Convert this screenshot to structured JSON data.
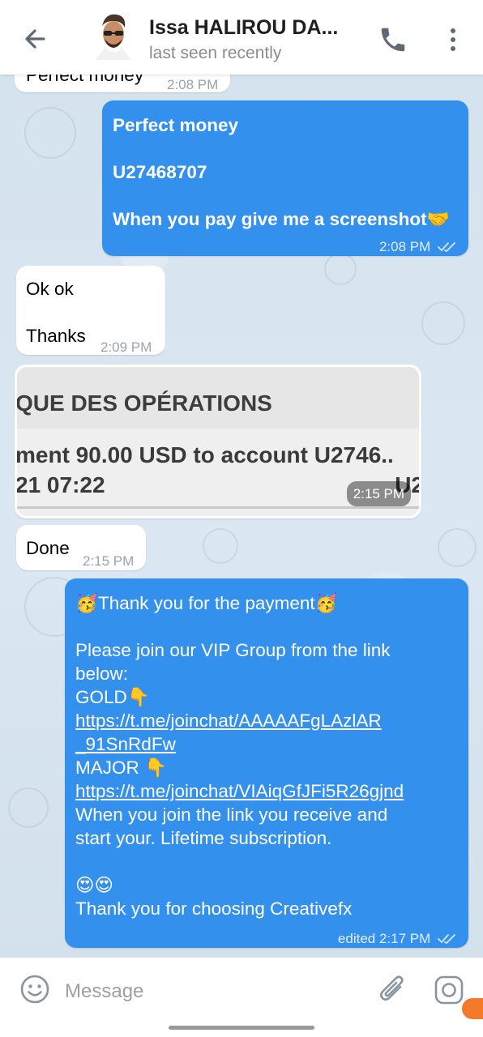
{
  "header": {
    "contact_name": "Issa HALIROU DA...",
    "status": "last seen recently"
  },
  "messages": {
    "partial": {
      "text": "Perfect money",
      "time": "2:08 PM"
    },
    "m1": {
      "line1": "Perfect money",
      "line2": "U27468707",
      "line3": "When you pay give me a screenshot🤝",
      "time": "2:08 PM"
    },
    "m2": {
      "line1": "Ok ok",
      "line2": "Thanks",
      "time": "2:09 PM"
    },
    "photo": {
      "line1": "QUE DES OPÉRATIONS",
      "line2": "ment 90.00 USD to account U2746..",
      "line3": "21 07:22",
      "line3_right": "U2",
      "time": "2:15 PM"
    },
    "m3": {
      "text": "Done",
      "time": "2:15 PM"
    },
    "m4": {
      "l1": "🥳Thank you for the payment🥳",
      "l2": "Please join our VIP Group from the link",
      "l3": "below:",
      "l4": "GOLD👇",
      "l5": "https://t.me/joinchat/AAAAAFgLAzlAR",
      "l6": "_91SnRdFw",
      "l7": "MAJOR 👇",
      "l8": "https://t.me/joinchat/VIAiqGfJFi5R26gjnd",
      "l9": "When you join the link you receive and",
      "l10": "start your. Lifetime subscription.",
      "l11": "😍😍",
      "l12": "Thank you for choosing Creativefx",
      "time": "edited 2:17 PM"
    }
  },
  "input": {
    "placeholder": "Message"
  },
  "icons": {
    "back": "arrow-left-icon",
    "call": "phone-icon",
    "menu": "more-vertical-icon",
    "emoji": "smile-icon",
    "attach": "paperclip-icon",
    "camera": "camera-icon",
    "read": "double-check-icon"
  },
  "colors": {
    "outgoing_bubble": "#3390ec",
    "incoming_bubble": "#ffffff",
    "header_bg": "#ffffff"
  }
}
